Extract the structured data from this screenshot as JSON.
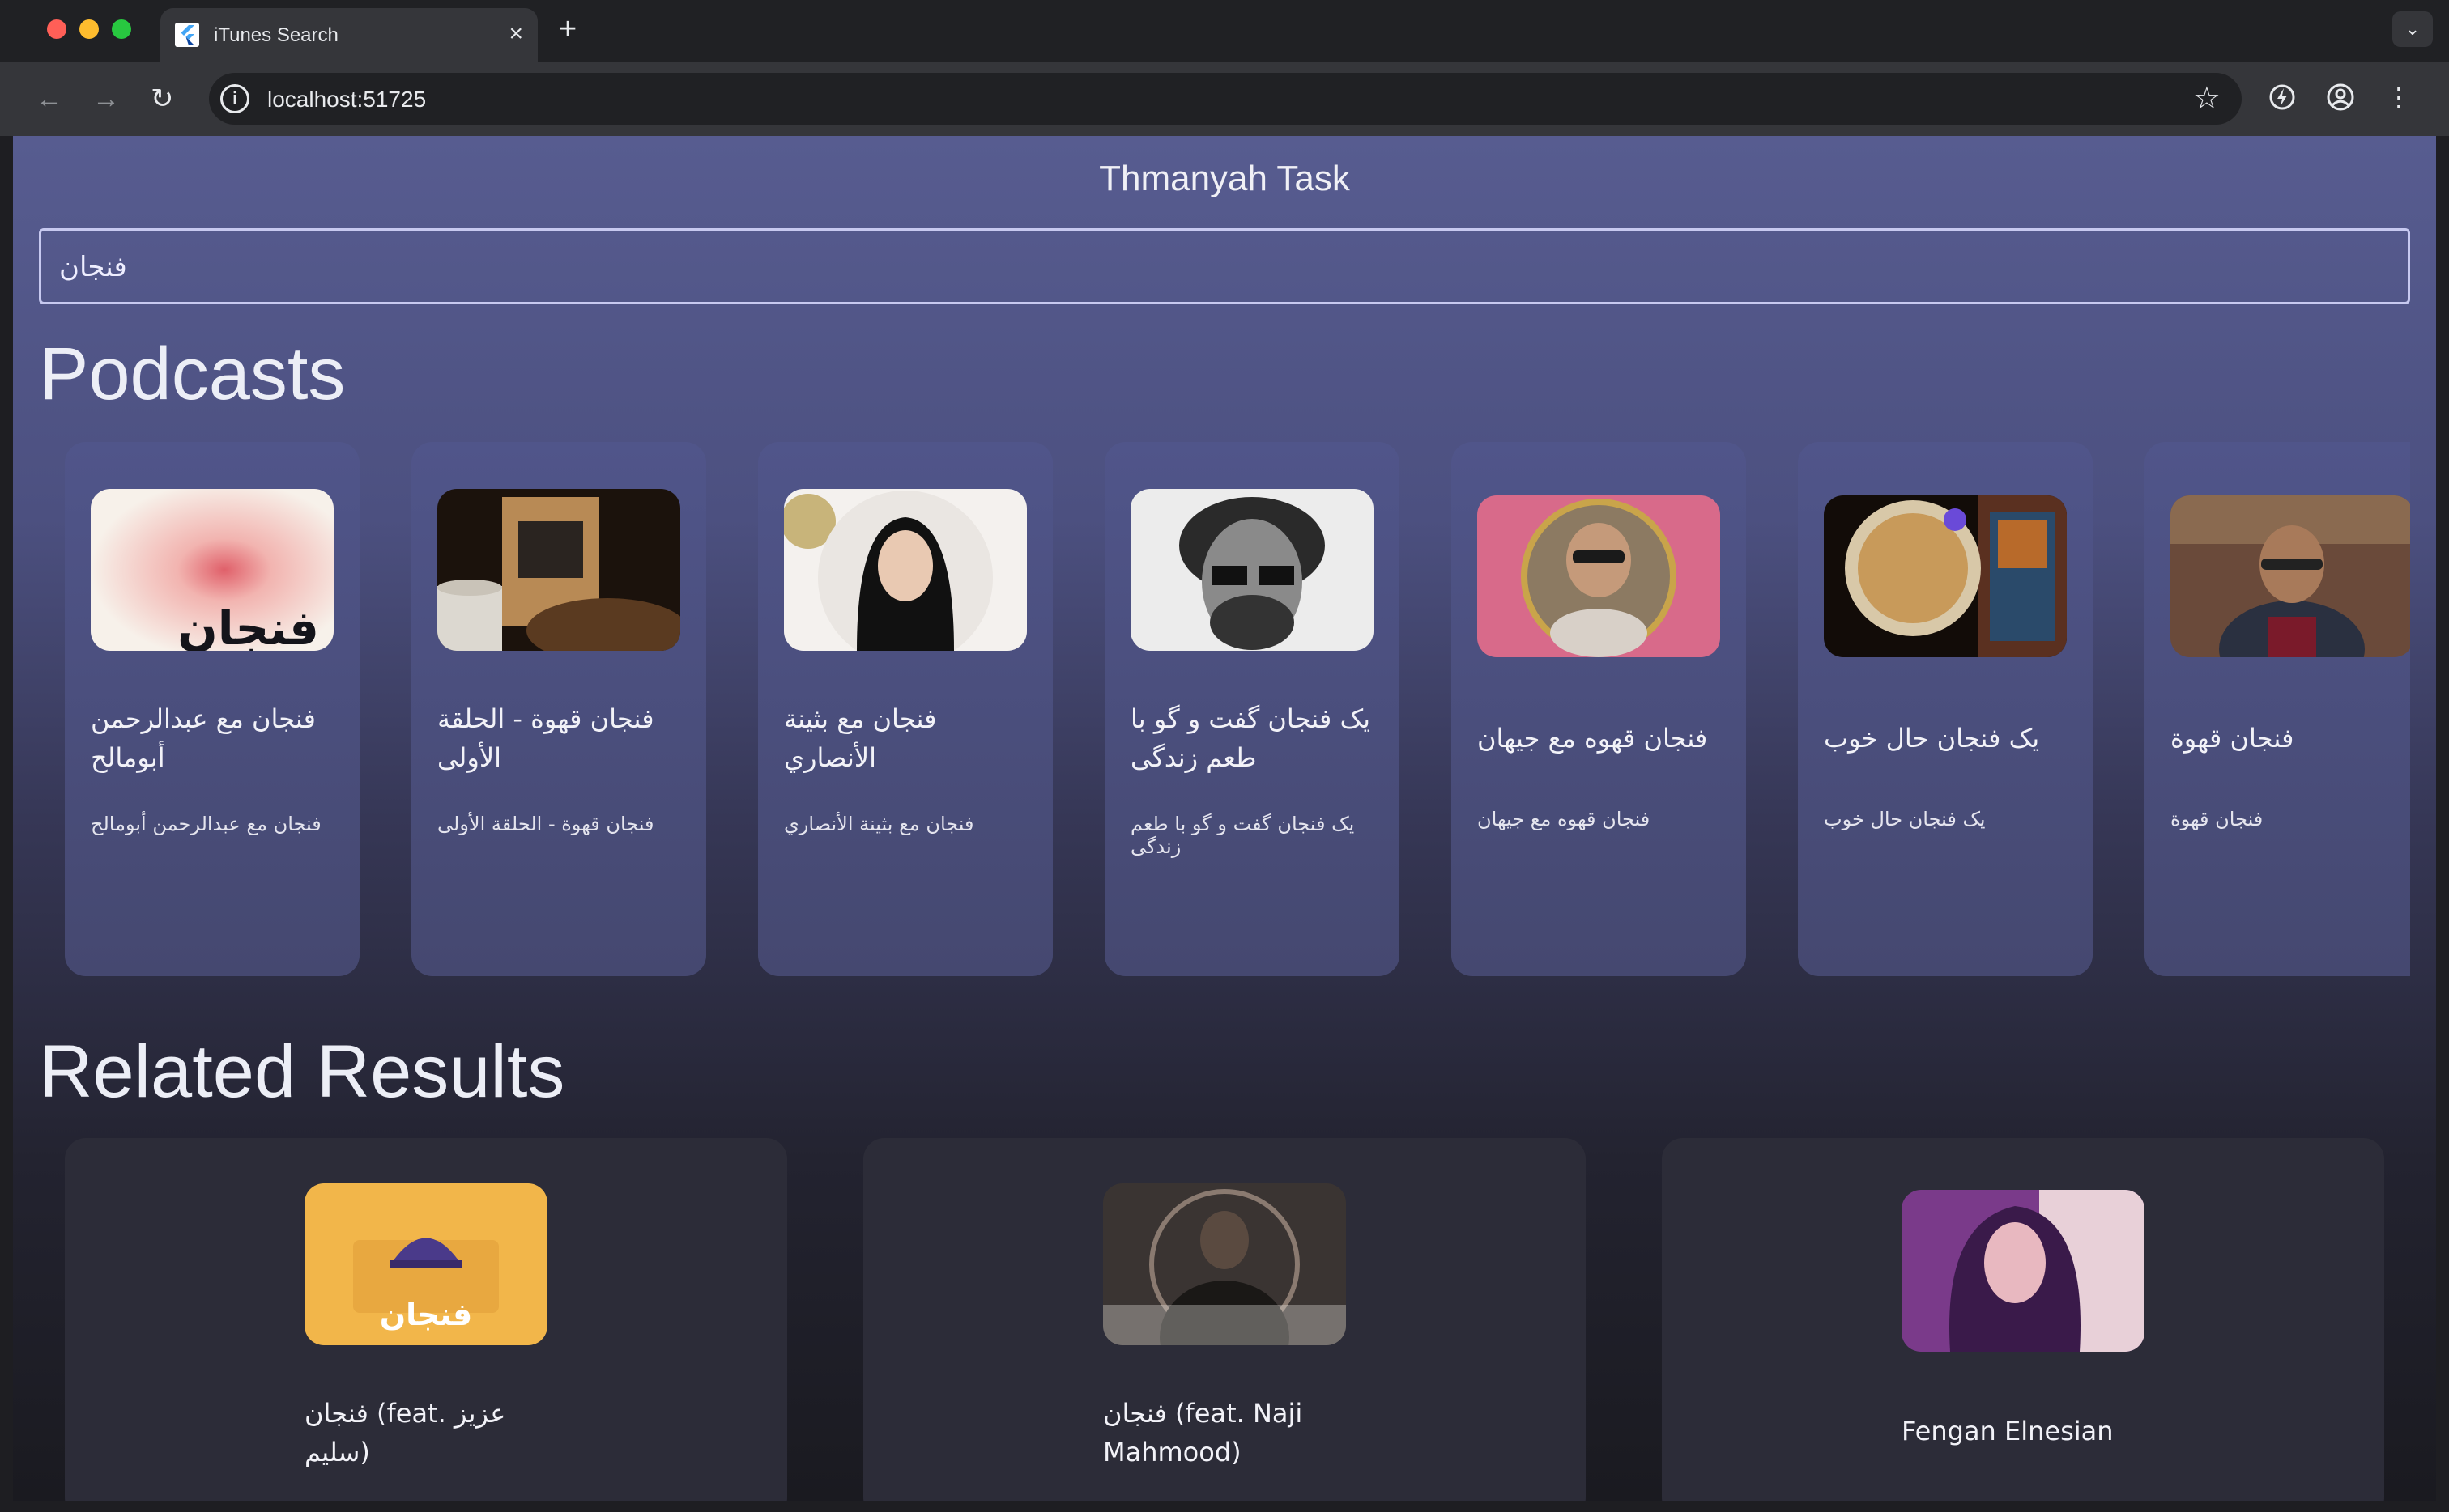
{
  "browser": {
    "tab_title": "iTunes Search",
    "url": "localhost:51725",
    "tab_close_glyph": "×",
    "new_tab_glyph": "+",
    "icons": [
      "flutter-icon",
      "close-icon",
      "plus-icon",
      "chevron-down-icon",
      "back-arrow-icon",
      "forward-arrow-icon",
      "reload-icon",
      "info-icon",
      "star-icon",
      "extension-icon",
      "profile-icon",
      "kebab-menu-icon"
    ]
  },
  "app": {
    "title": "Thmanyah Task",
    "search": {
      "value": "فنجان"
    }
  },
  "sections": {
    "podcasts_heading": "Podcasts",
    "related_heading": "Related Results"
  },
  "podcasts": [
    {
      "title": "فنجان مع عبدالرحمن أبومالح",
      "subtitle": "فنجان مع عبدالرحمن أبومالح",
      "art_text": "فنجان"
    },
    {
      "title": "فنجان قهوة - الحلقة الأولى",
      "subtitle": "فنجان قهوة - الحلقة الأولى"
    },
    {
      "title": "فنجان مع بثينة الأنصاري",
      "subtitle": "فنجان مع بثينة الأنصاري"
    },
    {
      "title": "یک فنجان گفت و گو با طعم زندگی",
      "subtitle": "یک فنجان گفت و گو با طعم زندگی"
    },
    {
      "title": "فنجان قهوه مع جيهان",
      "subtitle": "فنجان قهوه مع جيهان"
    },
    {
      "title": "یک فنجان حال خوب",
      "subtitle": "یک فنجان حال خوب"
    },
    {
      "title": "فنجان قهوة",
      "subtitle": "فنجان قهوة"
    }
  ],
  "related": [
    {
      "title": "فنجان (feat. عزيز سليم)",
      "art_text": "فنجان"
    },
    {
      "title": "فنجان (feat. Naji Mahmood)"
    },
    {
      "title": "Fengan Elnesian"
    }
  ],
  "colors": {
    "accent": "#c7c9f0",
    "card_top": "#50558a",
    "related_card": "#2c2c38",
    "gradient_top": "#575c90",
    "gradient_bottom": "#1a1a20"
  }
}
